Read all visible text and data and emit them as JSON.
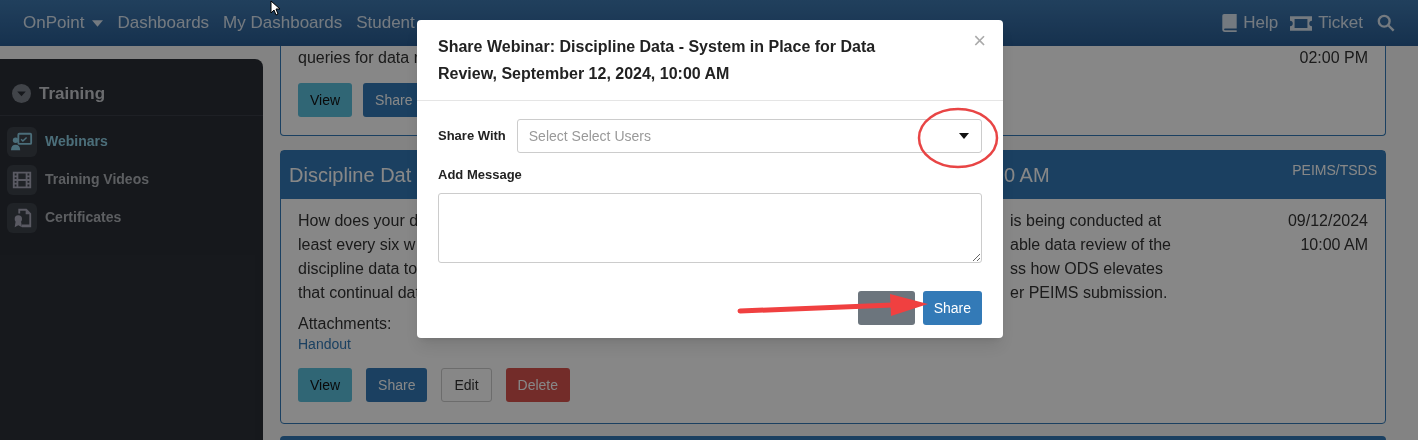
{
  "nav": {
    "brand": "OnPoint",
    "items": [
      "Dashboards",
      "My Dashboards",
      "Student"
    ],
    "right": [
      {
        "kind": "help",
        "label": "Help"
      },
      {
        "kind": "ticket",
        "label": "Ticket"
      }
    ]
  },
  "sidebar": {
    "section": "Training",
    "items": [
      {
        "label": "Webinars",
        "kind": "webinar",
        "selected": true
      },
      {
        "label": "Training Videos",
        "kind": "film",
        "selected": false
      },
      {
        "label": "Certificates",
        "kind": "certificate",
        "selected": false
      }
    ]
  },
  "previous_card": {
    "line": "queries for data r",
    "time": "02:00 PM",
    "buttons": [
      {
        "kind": "view",
        "label": "View"
      },
      {
        "kind": "share",
        "label": "Share"
      }
    ]
  },
  "card": {
    "title_start": "Discipline Dat",
    "title_end": "0 AM",
    "category": "PEIMS/TSDS",
    "lines": [
      {
        "start": "How does your d",
        "end": "is being conducted at"
      },
      {
        "start": "least every six w",
        "end": "able data review of the"
      },
      {
        "start": "discipline data to",
        "end": "ss how ODS elevates"
      },
      {
        "start": "that continual dat",
        "end": "er PEIMS submission."
      }
    ],
    "date": "09/12/2024",
    "time": "10:00 AM",
    "attachments_label": "Attachments:",
    "attachments": [
      "Handout"
    ],
    "buttons": [
      {
        "kind": "view",
        "label": "View"
      },
      {
        "kind": "share",
        "label": "Share"
      },
      {
        "kind": "edit",
        "label": "Edit"
      },
      {
        "kind": "delete",
        "label": "Delete"
      }
    ]
  },
  "modal": {
    "title": "Share Webinar: Discipline Data - System in Place for Data Review, September 12, 2024, 10:00 AM",
    "close": "×",
    "fields": [
      {
        "kind": "select",
        "label": "Share With",
        "placeholder": "Select Select Users"
      },
      {
        "kind": "textarea",
        "label": "Add Message"
      }
    ],
    "buttons": [
      {
        "kind": "secondary"
      },
      {
        "kind": "primary",
        "label": "Share"
      }
    ]
  }
}
